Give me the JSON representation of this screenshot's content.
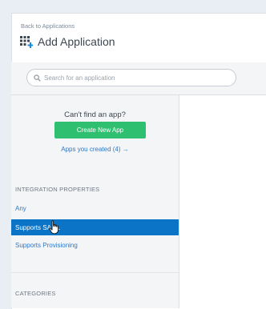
{
  "header": {
    "back_link": "Back to Applications",
    "title": "Add Application"
  },
  "search": {
    "placeholder": "Search for an application",
    "value": ""
  },
  "sidebar": {
    "cant_find": "Can't find an app?",
    "create_button": "Create New App",
    "apps_created_link": "Apps you created (4) →",
    "integration_properties": {
      "heading": "INTEGRATION PROPERTIES",
      "items": [
        {
          "label": "Any",
          "selected": false
        },
        {
          "label": "Supports SAML",
          "selected": true
        },
        {
          "label": "Supports Provisioning",
          "selected": false
        }
      ]
    },
    "categories": {
      "heading": "CATEGORIES"
    }
  },
  "colors": {
    "primary_button": "#2fbf71",
    "selected_item": "#0b74c6",
    "link": "#2f77c4",
    "title_icon_accent": "#1a8bd8"
  },
  "icons": {
    "title_icon": "app-grid-plus-icon",
    "search_icon": "search-icon",
    "cursor": "hand-pointer-cursor"
  }
}
